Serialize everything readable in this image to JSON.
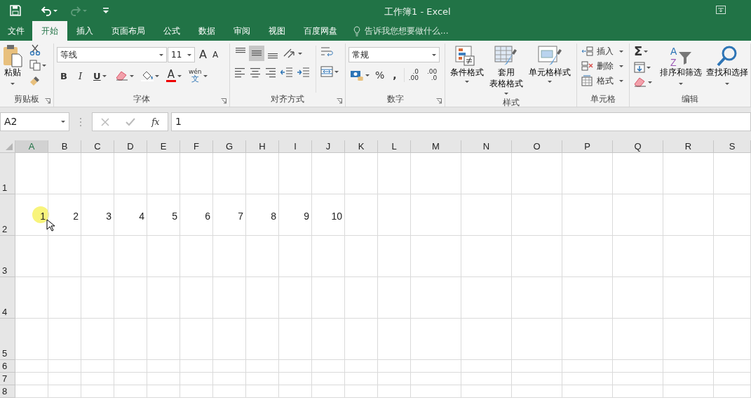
{
  "window": {
    "title": "工作簿1 - Excel"
  },
  "tabs": [
    {
      "label": "文件",
      "selected": false
    },
    {
      "label": "开始",
      "selected": true
    },
    {
      "label": "插入",
      "selected": false
    },
    {
      "label": "页面布局",
      "selected": false
    },
    {
      "label": "公式",
      "selected": false
    },
    {
      "label": "数据",
      "selected": false
    },
    {
      "label": "审阅",
      "selected": false
    },
    {
      "label": "视图",
      "selected": false
    },
    {
      "label": "百度网盘",
      "selected": false
    }
  ],
  "tell_me": {
    "placeholder": "告诉我您想要做什么..."
  },
  "clipboard": {
    "paste": "粘贴",
    "label": "剪贴板"
  },
  "font": {
    "name": "等线",
    "size": "11",
    "grow": "A",
    "shrink": "A",
    "format_buttons": [
      "B",
      "I",
      "U"
    ],
    "color_letter": "A",
    "phonetic_top": "wén",
    "phonetic_bottom": "文",
    "label": "字体"
  },
  "alignment": {
    "vertical_buttons": [
      {
        "kind": "top",
        "selected": false
      },
      {
        "kind": "middle",
        "selected": true
      },
      {
        "kind": "bottom",
        "selected": false
      }
    ],
    "label": "对齐方式"
  },
  "number": {
    "format": "常规",
    "percent": "%",
    "comma": ",",
    "increase_decimal": [
      ".0",
      ".00"
    ],
    "decrease_decimal": [
      ".00",
      ".0"
    ],
    "label": "数字"
  },
  "styles": {
    "buttons": [
      {
        "kind": "conditional",
        "label": "条件格式"
      },
      {
        "kind": "table",
        "lines": [
          "套用",
          "表格格式"
        ]
      },
      {
        "kind": "cell",
        "label": "单元格样式"
      }
    ],
    "label": "样式"
  },
  "cells": {
    "buttons": [
      {
        "kind": "insert",
        "label": "插入"
      },
      {
        "kind": "delete",
        "label": "删除"
      },
      {
        "kind": "format",
        "label": "格式"
      }
    ],
    "label": "单元格"
  },
  "editing": {
    "sum": "Σ",
    "sort_letters": [
      "A",
      "Z"
    ],
    "buttons": [
      {
        "kind": "sort",
        "label": "排序和筛选"
      },
      {
        "kind": "find",
        "label": "查找和选择"
      }
    ],
    "label": "编辑"
  },
  "formula_bar": {
    "name_box": "A2",
    "fx": "fx",
    "formula": "1"
  },
  "sheet": {
    "columns": [
      {
        "label": "A",
        "selected": true
      },
      {
        "label": "B",
        "selected": false
      },
      {
        "label": "C",
        "selected": false
      },
      {
        "label": "D",
        "selected": false
      },
      {
        "label": "E",
        "selected": false
      },
      {
        "label": "F",
        "selected": false
      },
      {
        "label": "G",
        "selected": false
      },
      {
        "label": "H",
        "selected": false
      },
      {
        "label": "I",
        "selected": false
      },
      {
        "label": "J",
        "selected": false
      },
      {
        "label": "K",
        "selected": false
      },
      {
        "label": "L",
        "selected": false
      },
      {
        "label": "M",
        "selected": false
      },
      {
        "label": "N",
        "selected": false
      },
      {
        "label": "O",
        "selected": false
      },
      {
        "label": "P",
        "selected": false
      },
      {
        "label": "Q",
        "selected": false
      },
      {
        "label": "R",
        "selected": false
      },
      {
        "label": "S",
        "selected": false
      }
    ],
    "rows": [
      {
        "header": "1",
        "cells": []
      },
      {
        "header": "2",
        "cells": [
          "1",
          "2",
          "3",
          "4",
          "5",
          "6",
          "7",
          "8",
          "9",
          "10"
        ]
      },
      {
        "header": "3",
        "cells": []
      },
      {
        "header": "4",
        "cells": []
      },
      {
        "header": "5",
        "cells": []
      },
      {
        "header": "6",
        "cells": []
      },
      {
        "header": "7",
        "cells": []
      },
      {
        "header": "8",
        "cells": []
      }
    ]
  }
}
